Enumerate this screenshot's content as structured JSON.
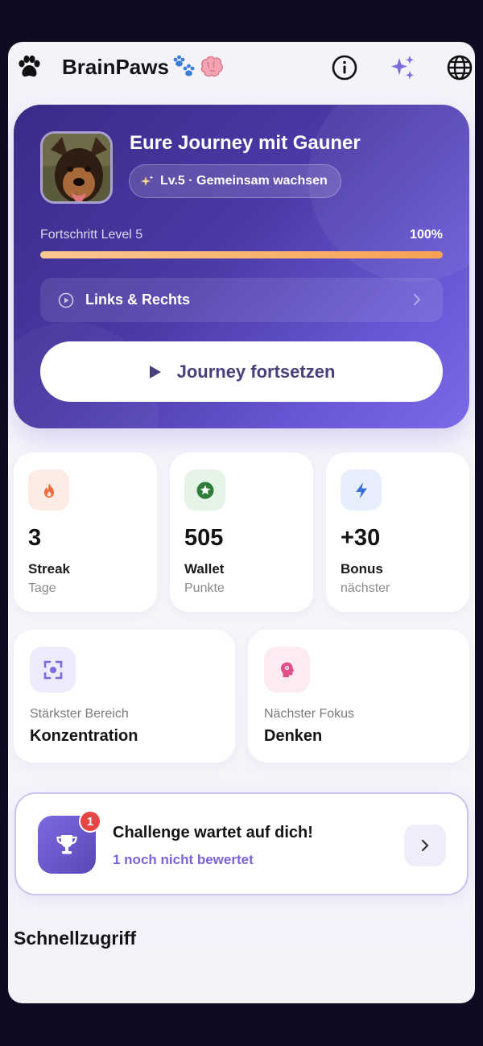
{
  "header": {
    "app_title": "BrainPaws",
    "icons": [
      "paw-icon",
      "paw-prints-icon",
      "brain-icon",
      "info-icon",
      "sparkles-icon",
      "globe-icon"
    ],
    "accent_color": "#7b6be0"
  },
  "hero": {
    "title": "Eure Journey mit Gauner",
    "level_pill": "Lv.5 · Gemeinsam wachsen",
    "progress_label": "Fortschritt Level 5",
    "progress_percent_text": "100%",
    "progress_value": 1.0,
    "next_item": "Links & Rechts",
    "continue_label": "Journey fortsetzen",
    "avatar": "dog-avatar"
  },
  "stats": [
    {
      "icon": "flame-icon",
      "value": "3",
      "label": "Streak",
      "sub": "Tage",
      "color": "#f06a3a"
    },
    {
      "icon": "star-badge-icon",
      "value": "505",
      "label": "Wallet",
      "sub": "Punkte",
      "color": "#2f9e44"
    },
    {
      "icon": "bolt-icon",
      "value": "+30",
      "label": "Bonus",
      "sub": "nächster",
      "color": "#3b6fd8"
    }
  ],
  "focus": [
    {
      "icon": "focus-target-icon",
      "label": "Stärkster Bereich",
      "value": "Konzentration",
      "color": "#7b6be0"
    },
    {
      "icon": "brain-head-icon",
      "label": "Nächster Fokus",
      "value": "Denken",
      "color": "#e0508a"
    }
  ],
  "challenge": {
    "title": "Challenge wartet auf dich!",
    "subtitle": "1 noch nicht bewertet",
    "badge_count": "1"
  },
  "quick_access": {
    "title": "Schnellzugriff"
  }
}
